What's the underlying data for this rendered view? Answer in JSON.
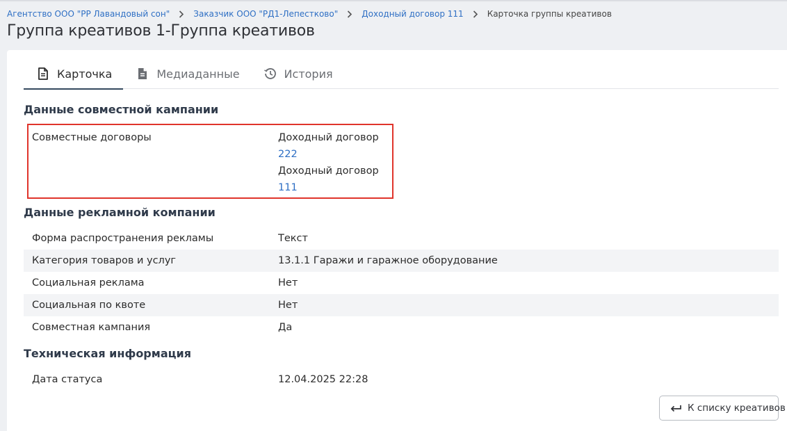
{
  "breadcrumb": {
    "items": [
      "Агентство ООО \"РР Лавандовый сон\"",
      "Заказчик ООО \"РД1-Лепестково\"",
      "Доходный договор 111"
    ],
    "current": "Карточка группы креативов"
  },
  "page_title": "Группа креативов 1-Группа креативов",
  "tabs": [
    {
      "label": "Карточка",
      "icon": "document-icon"
    },
    {
      "label": "Медиаданные",
      "icon": "file-icon"
    },
    {
      "label": "История",
      "icon": "history-icon"
    }
  ],
  "sections": {
    "joint": {
      "title": "Данные совместной кампании",
      "label": "Совместные договоры",
      "contracts": [
        {
          "text": "Доходный договор",
          "number": "222"
        },
        {
          "text": "Доходный договор",
          "number": "111"
        }
      ]
    },
    "ad": {
      "title": "Данные рекламной компании",
      "rows": [
        {
          "label": "Форма распространения рекламы",
          "value": "Текст"
        },
        {
          "label": "Категория товаров и услуг",
          "value": "13.1.1 Гаражи и гаражное оборудование"
        },
        {
          "label": "Социальная реклама",
          "value": "Нет"
        },
        {
          "label": "Социальная по квоте",
          "value": "Нет"
        },
        {
          "label": "Совместная кампания",
          "value": "Да"
        }
      ]
    },
    "tech": {
      "title": "Техническая информация",
      "rows": [
        {
          "label": "Дата статуса",
          "value": "12.04.2025 22:28"
        }
      ]
    }
  },
  "back_button": {
    "label": "К списку креативов",
    "icon": "return-arrow-icon"
  },
  "colors": {
    "link": "#2e6fc4",
    "highlight": "#e0342b",
    "tab_underline": "#34495e"
  }
}
